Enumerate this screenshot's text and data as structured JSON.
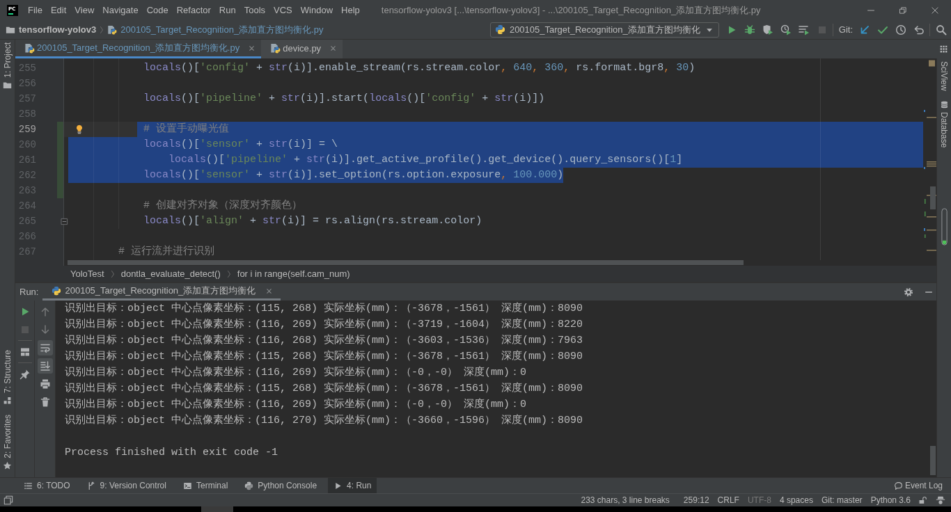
{
  "window": {
    "logo": "PC",
    "title": "tensorflow-yolov3 [...\\tensorflow-yolov3] - ...\\200105_Target_Recognition_添加直方图均衡化.py"
  },
  "menu": [
    "File",
    "Edit",
    "View",
    "Navigate",
    "Code",
    "Refactor",
    "Run",
    "Tools",
    "VCS",
    "Window",
    "Help"
  ],
  "navbar": {
    "breadcrumbs": [
      {
        "kind": "project",
        "label": "tensorflow-yolov3",
        "modified": false
      },
      {
        "kind": "file",
        "label": "200105_Target_Recognition_添加直方图均衡化.py",
        "modified": true
      }
    ],
    "run_config": "200105_Target_Recognition_添加直方图均衡化",
    "actions": [
      {
        "kind": "run",
        "disabled": false
      },
      {
        "kind": "debug",
        "disabled": false
      },
      {
        "kind": "coverage",
        "disabled": false
      },
      {
        "kind": "profile",
        "disabled": false
      },
      {
        "kind": "concurrency",
        "disabled": false
      },
      {
        "kind": "stop",
        "disabled": true
      }
    ],
    "vcs_label": "Git:",
    "vcs_actions": [
      {
        "kind": "update",
        "disabled": false
      },
      {
        "kind": "commit",
        "disabled": false
      },
      {
        "kind": "history",
        "disabled": false
      },
      {
        "kind": "revert",
        "disabled": false
      }
    ]
  },
  "left_strip": {
    "top": [
      {
        "kind": "project",
        "label": "1: Project"
      }
    ],
    "bottom": [
      {
        "kind": "structure",
        "label": "7: Structure"
      },
      {
        "kind": "favorites",
        "label": "2: Favorites"
      }
    ]
  },
  "right_strip": [
    {
      "kind": "sciview",
      "label": "SciView"
    },
    {
      "kind": "database",
      "label": "Database"
    }
  ],
  "editor_tabs": [
    {
      "label": "200105_Target_Recognition_添加直方图均衡化.py",
      "modified": true,
      "selected": true
    },
    {
      "label": "device.py",
      "modified": false,
      "selected": false
    }
  ],
  "editor": {
    "lines": [
      {
        "number": "255",
        "selected": false,
        "current": false,
        "changed": false,
        "fold": false,
        "tokens": [
          {
            "kind": "builtin",
            "text": "            locals"
          },
          {
            "kind": "plain",
            "text": "()["
          },
          {
            "kind": "string",
            "text": "'config'"
          },
          {
            "kind": "plain",
            "text": " + "
          },
          {
            "kind": "builtin",
            "text": "str"
          },
          {
            "kind": "plain",
            "text": "(i)].enable_stream(rs.stream.color"
          },
          {
            "kind": "punct",
            "text": ","
          },
          {
            "kind": "number",
            "text": " 640"
          },
          {
            "kind": "punct",
            "text": ","
          },
          {
            "kind": "number",
            "text": " 360"
          },
          {
            "kind": "punct",
            "text": ","
          },
          {
            "kind": "plain",
            "text": " rs.format.bgr8"
          },
          {
            "kind": "punct",
            "text": ","
          },
          {
            "kind": "number",
            "text": " 30"
          },
          {
            "kind": "plain",
            "text": ")"
          }
        ]
      },
      {
        "number": "256",
        "selected": false,
        "current": false,
        "changed": false,
        "fold": false
      },
      {
        "number": "257",
        "selected": false,
        "current": false,
        "changed": false,
        "fold": false,
        "tokens": [
          {
            "kind": "builtin",
            "text": "            locals"
          },
          {
            "kind": "plain",
            "text": "()["
          },
          {
            "kind": "string",
            "text": "'pipeline'"
          },
          {
            "kind": "plain",
            "text": " + "
          },
          {
            "kind": "builtin",
            "text": "str"
          },
          {
            "kind": "plain",
            "text": "(i)].start("
          },
          {
            "kind": "builtin",
            "text": "locals"
          },
          {
            "kind": "plain",
            "text": "()["
          },
          {
            "kind": "string",
            "text": "'config'"
          },
          {
            "kind": "plain",
            "text": " + "
          },
          {
            "kind": "builtin",
            "text": "str"
          },
          {
            "kind": "plain",
            "text": "(i)])"
          }
        ]
      },
      {
        "number": "258",
        "selected": false,
        "current": false,
        "changed": false,
        "fold": false
      },
      {
        "number": "259",
        "selected": true,
        "current": true,
        "changed": true,
        "fold": false,
        "tokens": [
          {
            "kind": "comment",
            "text": "            # 设置手动曝光值"
          }
        ]
      },
      {
        "number": "260",
        "selected": true,
        "current": false,
        "changed": true,
        "fold": false,
        "tokens": [
          {
            "kind": "builtin",
            "text": "            locals"
          },
          {
            "kind": "plain",
            "text": "()["
          },
          {
            "kind": "string",
            "text": "'sensor'"
          },
          {
            "kind": "plain",
            "text": " + "
          },
          {
            "kind": "builtin",
            "text": "str"
          },
          {
            "kind": "plain",
            "text": "(i)] = \\"
          }
        ]
      },
      {
        "number": "261",
        "selected": true,
        "current": false,
        "changed": true,
        "fold": false,
        "tokens": [
          {
            "kind": "builtin",
            "text": "                locals"
          },
          {
            "kind": "plain",
            "text": "()["
          },
          {
            "kind": "string",
            "text": "'pipeline'"
          },
          {
            "kind": "plain",
            "text": " + "
          },
          {
            "kind": "builtin",
            "text": "str"
          },
          {
            "kind": "plain",
            "text": "(i)].get_active_profile().get_device().query_sensors()["
          },
          {
            "kind": "number",
            "text": "1"
          },
          {
            "kind": "plain",
            "text": "]"
          }
        ]
      },
      {
        "number": "262",
        "selected": true,
        "current": false,
        "changed": true,
        "fold": false,
        "tokens": [
          {
            "kind": "builtin",
            "text": "            locals"
          },
          {
            "kind": "plain",
            "text": "()["
          },
          {
            "kind": "string",
            "text": "'sensor'"
          },
          {
            "kind": "plain",
            "text": " + "
          },
          {
            "kind": "builtin",
            "text": "str"
          },
          {
            "kind": "plain",
            "text": "(i)].set_option(rs.option.exposure"
          },
          {
            "kind": "punct",
            "text": ","
          },
          {
            "kind": "number",
            "text": " 100.000"
          },
          {
            "kind": "plain",
            "text": ")"
          }
        ]
      },
      {
        "number": "263",
        "selected": false,
        "current": false,
        "changed": true,
        "fold": false
      },
      {
        "number": "264",
        "selected": false,
        "current": false,
        "changed": false,
        "fold": false,
        "tokens": [
          {
            "kind": "comment",
            "text": "            # 创建对齐对象（深度对齐颜色）"
          }
        ]
      },
      {
        "number": "265",
        "selected": false,
        "current": false,
        "changed": false,
        "fold": true,
        "tokens": [
          {
            "kind": "builtin",
            "text": "            locals"
          },
          {
            "kind": "plain",
            "text": "()["
          },
          {
            "kind": "string",
            "text": "'align'"
          },
          {
            "kind": "plain",
            "text": " + "
          },
          {
            "kind": "builtin",
            "text": "str"
          },
          {
            "kind": "plain",
            "text": "(i)] = rs.align(rs.stream.color)"
          }
        ]
      },
      {
        "number": "266",
        "selected": false,
        "current": false,
        "changed": false,
        "fold": false
      },
      {
        "number": "267",
        "selected": false,
        "current": false,
        "changed": false,
        "fold": false,
        "tokens": [
          {
            "kind": "comment",
            "text": "        # 运行流并进行识别"
          }
        ]
      }
    ]
  },
  "breadcrumbs": [
    "YoloTest",
    "dontla_evaluate_detect()",
    "for i in range(self.cam_num)"
  ],
  "run_panel": {
    "label": "Run:",
    "tabs": [
      {
        "label": "200105_Target_Recognition_添加直方图均衡化",
        "selected": true
      }
    ],
    "toolbar": [
      {
        "kind": "rerun",
        "on": false,
        "disabled": false
      },
      {
        "kind": "stop",
        "on": false,
        "disabled": true
      },
      {
        "kind": "layout",
        "on": false,
        "disabled": false
      },
      {
        "kind": "pin",
        "on": false,
        "disabled": false
      }
    ],
    "toolbar_secondary": [
      {
        "kind": "up",
        "on": false,
        "disabled": true
      },
      {
        "kind": "down",
        "on": false,
        "disabled": true
      },
      {
        "kind": "softwrap",
        "on": true,
        "disabled": false
      },
      {
        "kind": "scrollend",
        "on": true,
        "disabled": false
      },
      {
        "kind": "print",
        "on": false,
        "disabled": false
      },
      {
        "kind": "clear",
        "on": false,
        "disabled": false
      }
    ],
    "output": [
      {
        "kind": "log",
        "text": "识别出目标：object 中心点像素坐标：(115, 268) 实际坐标(mm)：（-3678，-1561） 深度(mm)：8090"
      },
      {
        "kind": "log",
        "text": "识别出目标：object 中心点像素坐标：(116, 269) 实际坐标(mm)：（-3719，-1604） 深度(mm)：8220"
      },
      {
        "kind": "log",
        "text": "识别出目标：object 中心点像素坐标：(116, 268) 实际坐标(mm)：（-3603，-1536） 深度(mm)：7963"
      },
      {
        "kind": "log",
        "text": "识别出目标：object 中心点像素坐标：(115, 268) 实际坐标(mm)：（-3678，-1561） 深度(mm)：8090"
      },
      {
        "kind": "log",
        "text": "识别出目标：object 中心点像素坐标：(116, 269) 实际坐标(mm)：（-0，-0） 深度(mm)：0"
      },
      {
        "kind": "log",
        "text": "识别出目标：object 中心点像素坐标：(115, 268) 实际坐标(mm)：（-3678，-1561） 深度(mm)：8090"
      },
      {
        "kind": "log",
        "text": "识别出目标：object 中心点像素坐标：(116, 269) 实际坐标(mm)：（-0，-0） 深度(mm)：0"
      },
      {
        "kind": "log",
        "text": "识别出目标：object 中心点像素坐标：(116, 270) 实际坐标(mm)：（-3660，-1596） 深度(mm)：8090"
      },
      {
        "kind": "exit",
        "text": "Process finished with exit code -1"
      }
    ]
  },
  "tool_windows": {
    "items": [
      {
        "kind": "todo",
        "label": "6: TODO",
        "selected": false
      },
      {
        "kind": "vcs",
        "label": "9: Version Control",
        "selected": false
      },
      {
        "kind": "terminal",
        "label": "Terminal",
        "selected": false
      },
      {
        "kind": "console",
        "label": "Python Console",
        "selected": false
      },
      {
        "kind": "run",
        "label": "4: Run",
        "selected": true
      }
    ],
    "event_log": "Event Log"
  },
  "status_bar": [
    {
      "text": "233 chars, 3 line breaks",
      "disabled": false
    },
    {
      "text": "259:12",
      "disabled": false
    },
    {
      "text": "CRLF",
      "disabled": false
    },
    {
      "text": "UTF-8",
      "disabled": true
    },
    {
      "text": "4 spaces",
      "disabled": false
    },
    {
      "text": "Git: master",
      "disabled": false
    },
    {
      "text": "Python 3.6",
      "disabled": false
    }
  ]
}
